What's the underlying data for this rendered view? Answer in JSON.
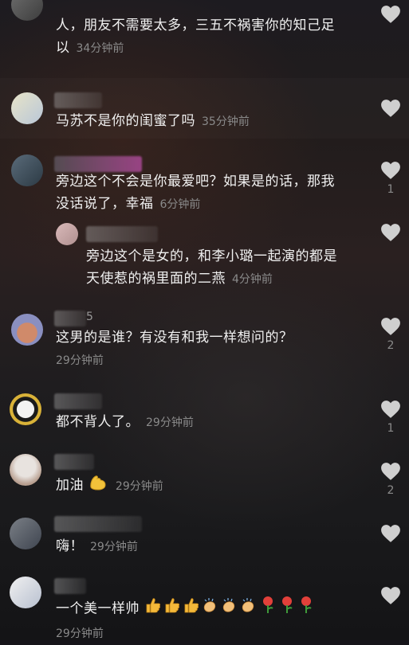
{
  "comments": [
    {
      "text": "人，朋友不需要太多，三五不祸害你的知己足以",
      "line1": "人，朋友不需要太多，三五不祸害你的知己足",
      "line2": "以",
      "time": "34分钟前",
      "likes": ""
    },
    {
      "text": "马苏不是你的闺蜜了吗",
      "time": "35分钟前",
      "likes": ""
    },
    {
      "line1": "旁边这个不会是你最爱吧？如果是的话，那我",
      "line2": "没话说了，幸福",
      "time": "6分钟前",
      "likes": "1"
    },
    {
      "line1": "旁边这个是女的，和李小璐一起演的都是",
      "line2": "天使惹的祸里面的二燕",
      "time": "4分钟前",
      "likes": ""
    },
    {
      "text": "这男的是谁？有没有和我一样想问的？",
      "time": "29分钟前",
      "likes": "2",
      "name_fragment": "5"
    },
    {
      "text": "都不背人了。",
      "time": "29分钟前",
      "likes": "1"
    },
    {
      "text": "加油",
      "time": "29分钟前",
      "likes": "2"
    },
    {
      "text": "嗨！",
      "time": "29分钟前",
      "likes": ""
    },
    {
      "text": "一个美一样帅",
      "time": "29分钟前",
      "likes": ""
    }
  ],
  "icons": {
    "like": "heart-icon",
    "muscle": "flexed-biceps-emoji",
    "thumb": "thumbs-up-emoji",
    "clap": "clapping-hands-emoji",
    "rose": "rose-emoji"
  },
  "colors": {
    "text": "#f0f0f0",
    "meta": "#8a8a8a",
    "heart": "#d9d9d9"
  }
}
